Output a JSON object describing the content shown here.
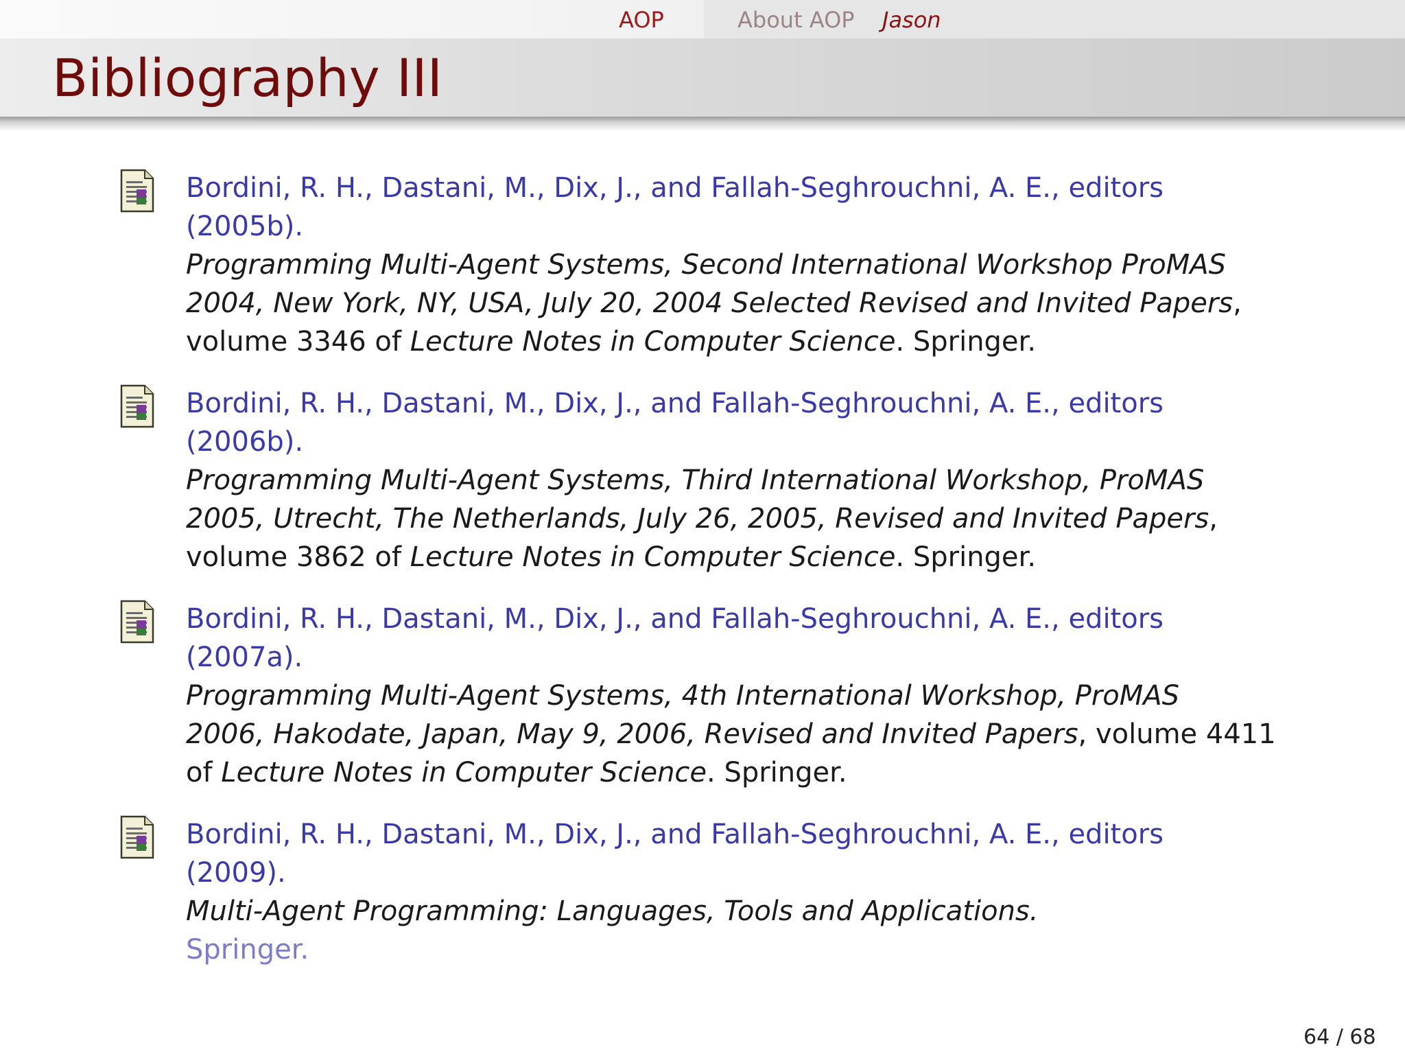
{
  "nav": {
    "items": [
      "AOP",
      "About AOP",
      "Jason"
    ]
  },
  "title": "Bibliography III",
  "entries": [
    {
      "authors_line1": "Bordini, R. H., Dastani, M., Dix, J., and Fallah-Seghrouchni, A. E., editors",
      "authors_line2": "(2005b).",
      "title_line1": "Programming Multi-Agent Systems, Second International Workshop ProMAS",
      "title_line2": "2004, New York, NY, USA, July 20, 2004 Selected Revised and Invited Papers",
      "after_title": ",",
      "volume_prefix": "volume 3346 of ",
      "series": "Lecture Notes in Computer Science",
      "publisher": ". Springer."
    },
    {
      "authors_line1": "Bordini, R. H., Dastani, M., Dix, J., and Fallah-Seghrouchni, A. E., editors",
      "authors_line2": "(2006b).",
      "title_line1": "Programming Multi-Agent Systems, Third International Workshop, ProMAS",
      "title_line2": "2005, Utrecht, The Netherlands, July 26, 2005, Revised and Invited Papers",
      "after_title": ",",
      "volume_prefix": "volume 3862 of ",
      "series": "Lecture Notes in Computer Science",
      "publisher": ". Springer."
    },
    {
      "authors_line1": "Bordini, R. H., Dastani, M., Dix, J., and Fallah-Seghrouchni, A. E., editors",
      "authors_line2": "(2007a).",
      "title_line1": "Programming Multi-Agent Systems, 4th International Workshop, ProMAS",
      "title_line2": "2006, Hakodate, Japan, May 9, 2006, Revised and Invited Papers",
      "after_title": ", volume 4411",
      "volume_prefix": "of ",
      "series": "Lecture Notes in Computer Science",
      "publisher": ". Springer."
    },
    {
      "authors_line1": "Bordini, R. H., Dastani, M., Dix, J., and Fallah-Seghrouchni, A. E., editors",
      "authors_line2": "(2009).",
      "title_line1": "Multi-Agent Programming: Languages, Tools and Applications.",
      "publisher": "Springer."
    }
  ],
  "page": {
    "current": "64",
    "separator": "/",
    "total": "68"
  }
}
